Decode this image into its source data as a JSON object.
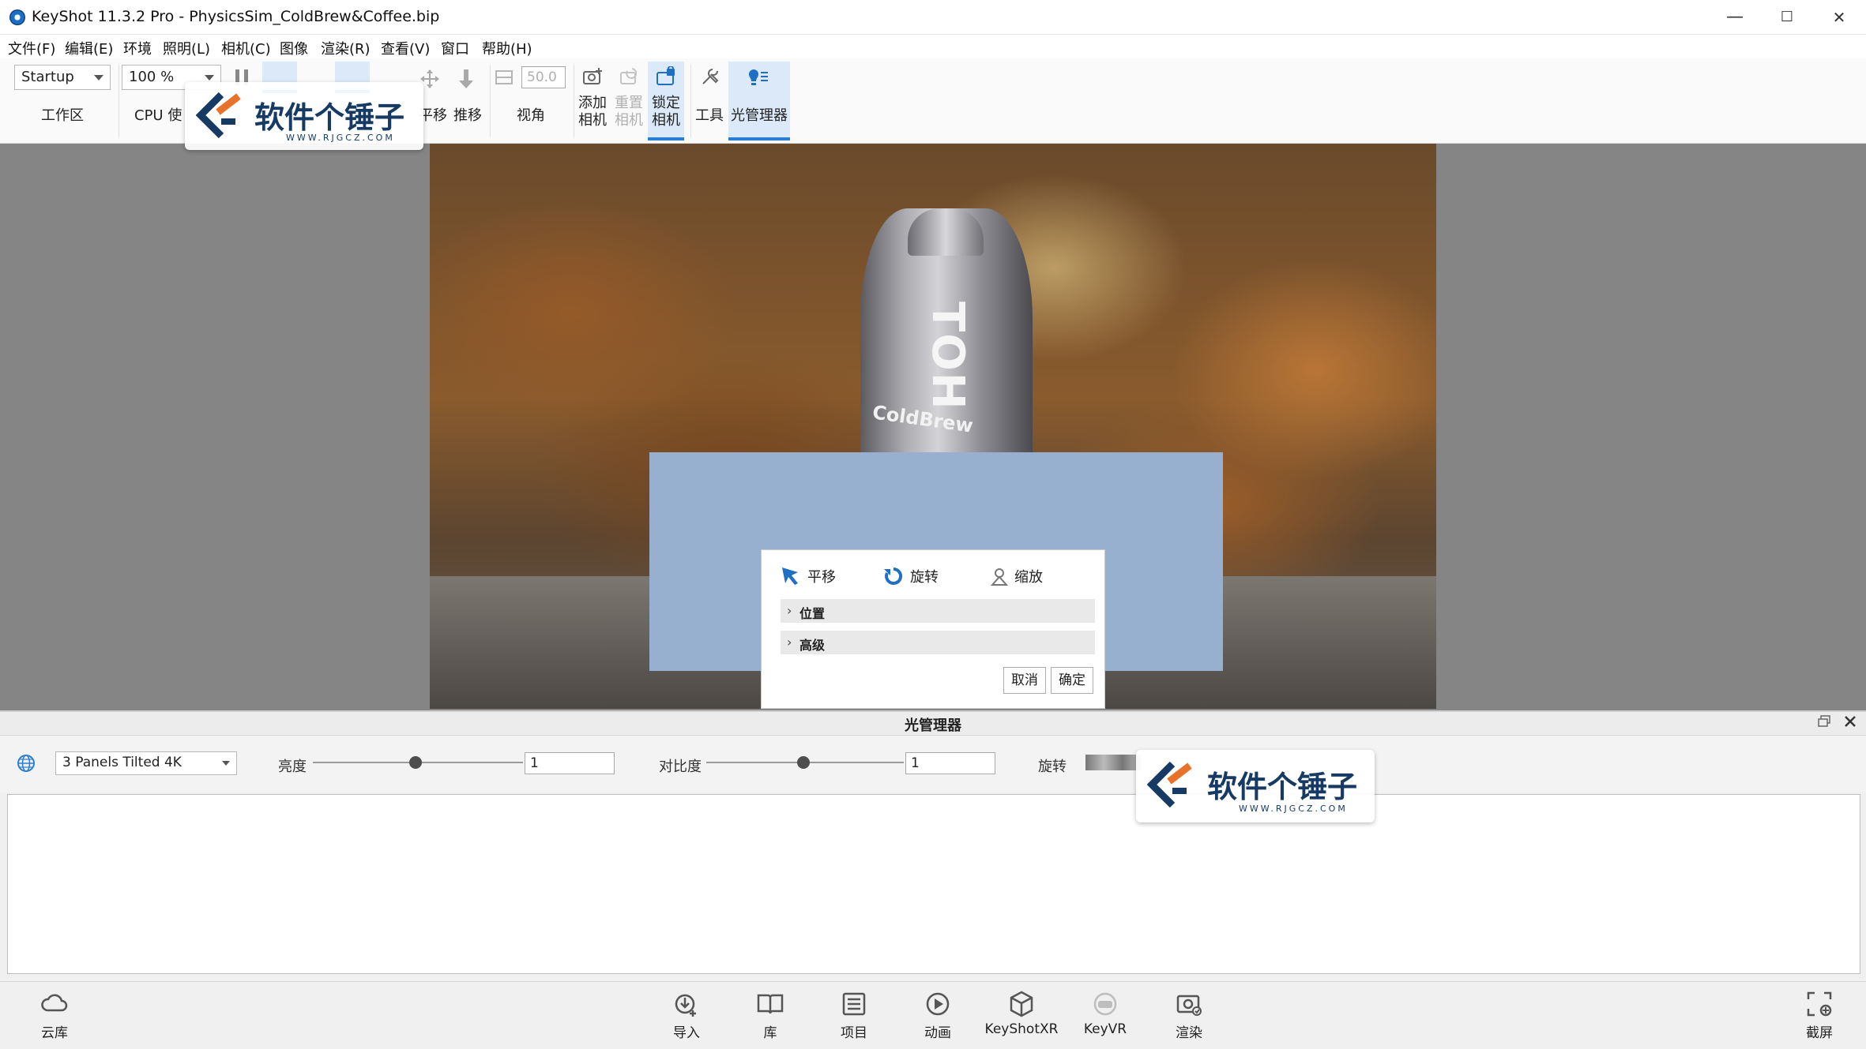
{
  "window": {
    "title": "KeyShot 11.3.2 Pro  - PhysicsSim_ColdBrew&Coffee.bip",
    "minimize": "—",
    "maximize": "☐",
    "close": "✕"
  },
  "menu": [
    "文件(F)",
    "编辑(E)",
    "环境",
    "照明(L)",
    "相机(C)",
    "图像",
    "渲染(R)",
    "查看(V)",
    "窗口",
    "帮助(H)"
  ],
  "toolbar": {
    "workspace_value": "Startup",
    "workspace_label": "工作区",
    "zoom_value": "100 %",
    "cpu_label": "CPU 使",
    "pan_label": "平移",
    "dolly_label": "推移",
    "fov_value": "50.0",
    "view_label": "视角",
    "add_camera_label": "添加\n相机",
    "reset_camera_label": "重置\n相机",
    "lock_camera_label": "锁定\n相机",
    "tools_label": "工具",
    "light_manager_label": "光管理器"
  },
  "render": {
    "bottle_text": "ColdBrew",
    "bottle_vertical_text": "TOH"
  },
  "dialog": {
    "tab_pan": "平移",
    "tab_rotate": "旋转",
    "tab_scale": "缩放",
    "section_position": "位置",
    "section_advanced": "高级",
    "cancel": "取消",
    "ok": "确定"
  },
  "light_manager": {
    "title": "光管理器",
    "preset_value": "3 Panels Tilted 4K",
    "brightness_label": "亮度",
    "brightness_value": "1",
    "brightness_level": 0.49,
    "contrast_label": "对比度",
    "contrast_value": "1",
    "contrast_level": 0.49,
    "rotation_label": "旋转"
  },
  "bottombar": {
    "cloud": "云库",
    "import": "导入",
    "library": "库",
    "project": "项目",
    "animation": "动画",
    "keyshotxr": "KeyShotXR",
    "keyvr": "KeyVR",
    "render": "渲染",
    "screenshot": "截屏"
  },
  "watermark": {
    "text": "软件个锤子",
    "sub": "WWW.RJGCZ.COM"
  },
  "colors": {
    "accent": "#2a7fd4",
    "panel_blue": "#98b0cf",
    "watermark_blue": "#163a63"
  }
}
